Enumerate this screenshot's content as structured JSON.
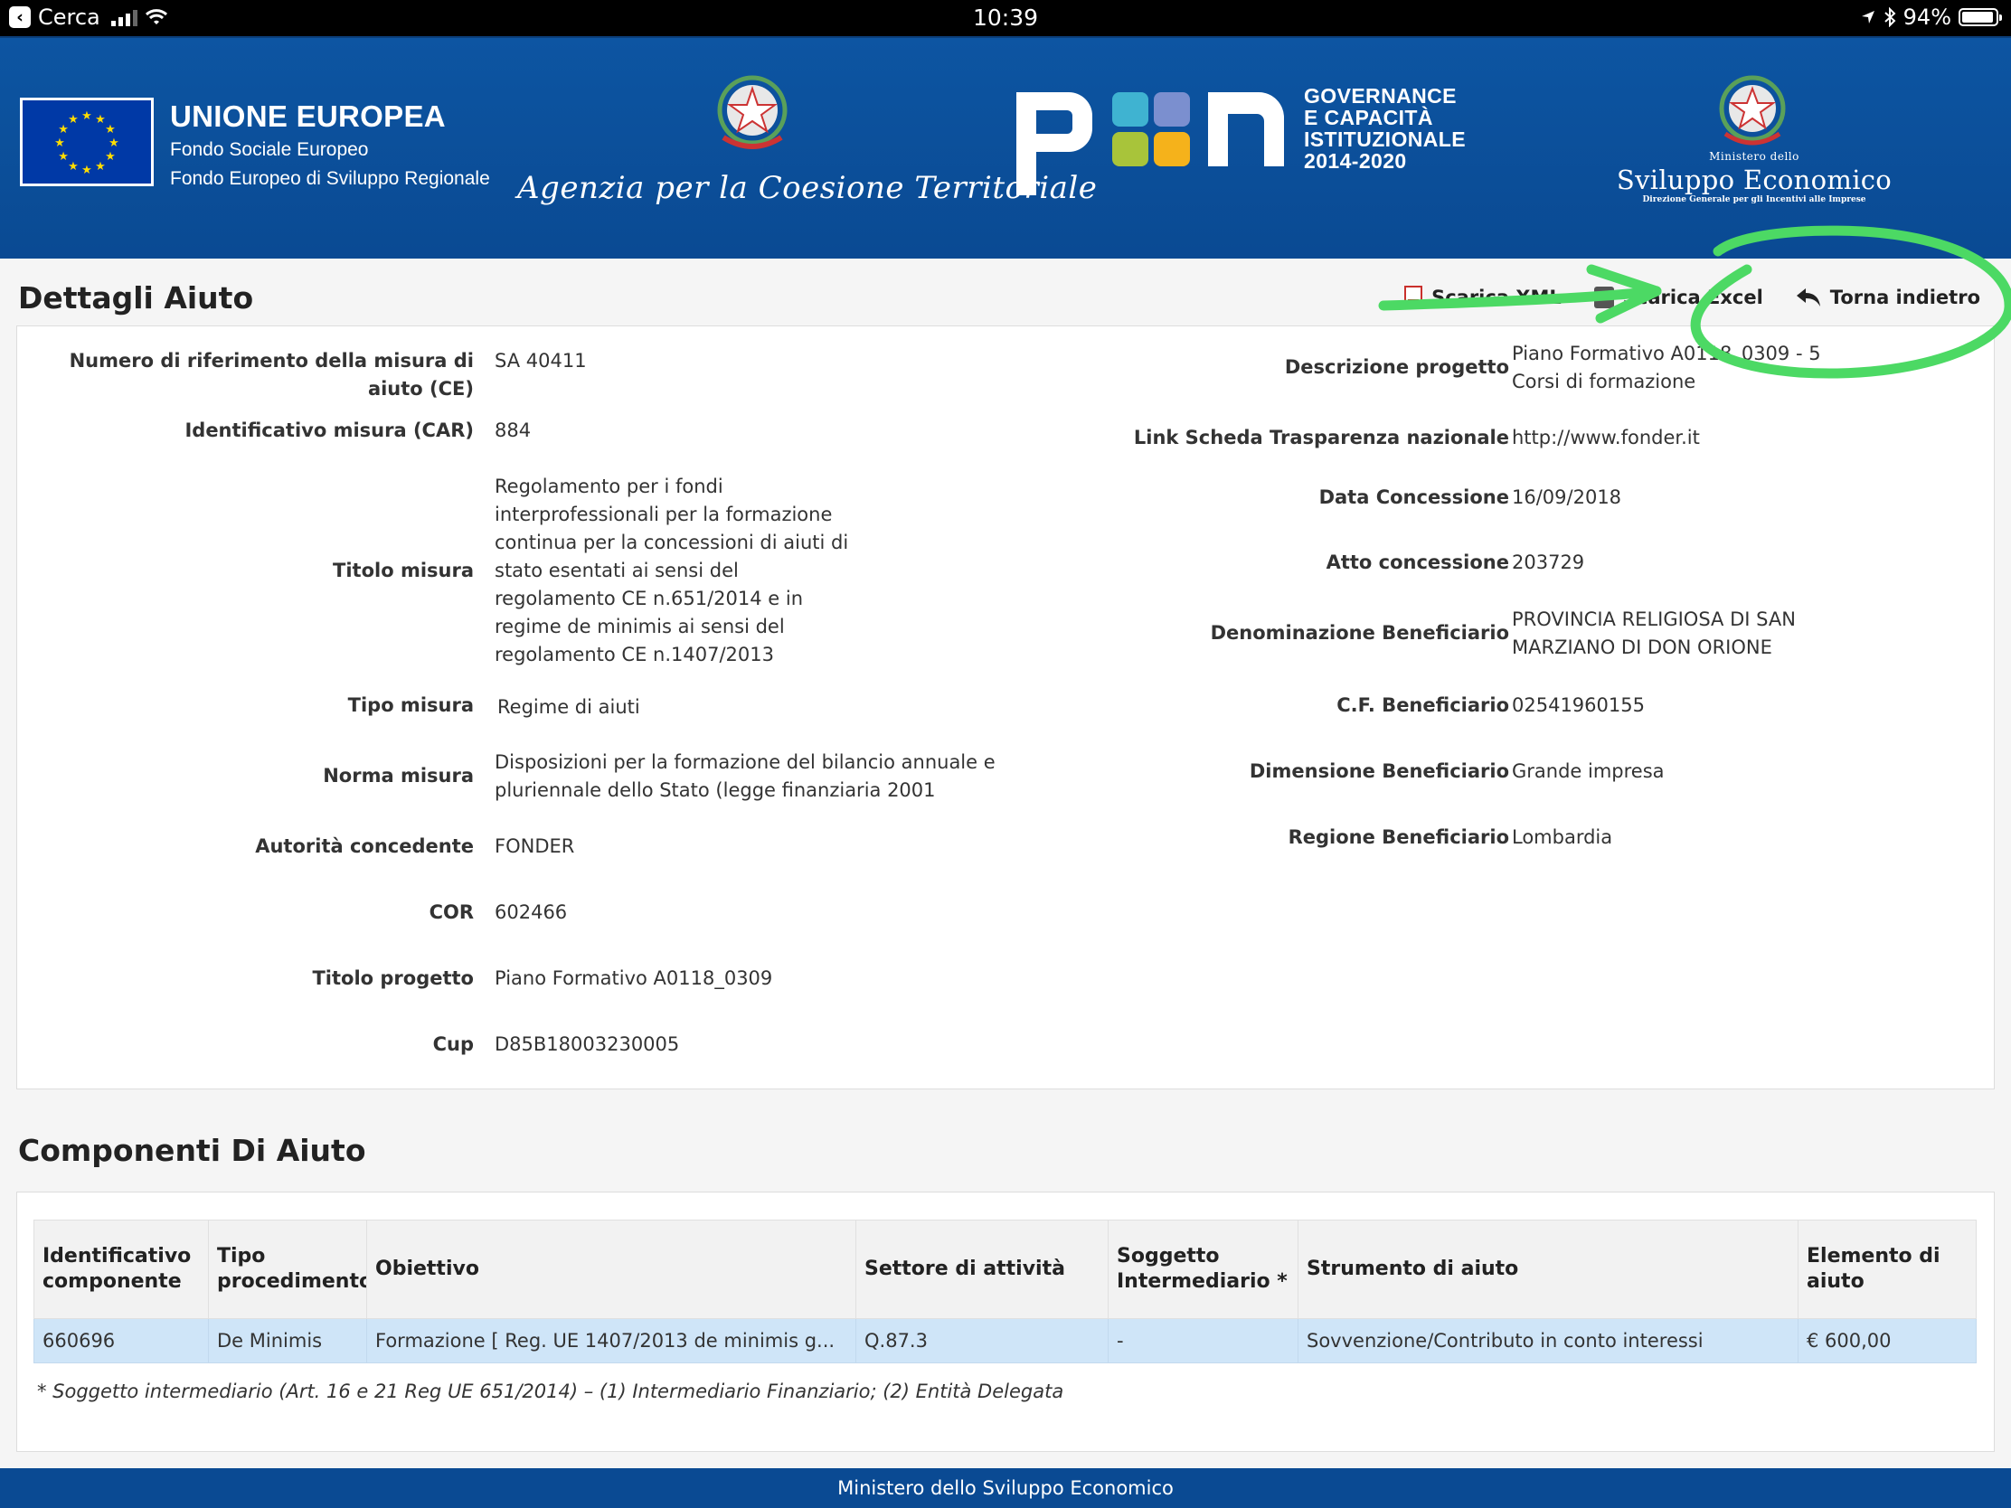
{
  "status_bar": {
    "back_app": "Cerca",
    "time": "10:39",
    "battery": "94%",
    "battery_level": 0.94
  },
  "banner": {
    "eu_title": "UNIONE EUROPEA",
    "eu_line1": "Fondo Sociale Europeo",
    "eu_line2": "Fondo Europeo di Sviluppo Regionale",
    "agency": "Agenzia per la Coesione Territoriale",
    "pon_line1": "GOVERNANCE",
    "pon_line2": "E CAPACITÀ",
    "pon_line3": "ISTITUZIONALE",
    "pon_line4": "2014-2020",
    "mise_small": "Ministero dello",
    "mise_big": "Sviluppo Economico",
    "mise_tiny": "Direzione Generale per gli Incentivi alle Imprese"
  },
  "page": {
    "title": "Dettagli Aiuto",
    "actions": {
      "pdf": "Scarica XML",
      "excel": "Scarica Excel",
      "back": "Torna indietro"
    }
  },
  "details_left": [
    {
      "label": "Numero di riferimento della misura di aiuto (CE)",
      "value": "SA 40411"
    },
    {
      "label": "Identificativo misura (CAR)",
      "value": "884"
    },
    {
      "label": "Titolo misura",
      "value": "Regolamento per i fondi interprofessionali per la formazione continua per la concessioni di aiuti di stato esentati ai sensi del regolamento CE n.651/2014 e in regime de minimis ai sensi del regolamento CE n.1407/2013"
    },
    {
      "label": "Tipo misura",
      "value": "Regime di aiuti"
    },
    {
      "label": "Norma misura",
      "value": "Disposizioni per la formazione del bilancio annuale e pluriennale dello Stato (legge finanziaria 2001"
    },
    {
      "label": "Autorità concedente",
      "value": "FONDER"
    },
    {
      "label": "COR",
      "value": "602466"
    },
    {
      "label": "Titolo progetto",
      "value": "Piano Formativo A0118_0309"
    },
    {
      "label": "Cup",
      "value": "D85B18003230005"
    }
  ],
  "details_right": [
    {
      "label": "Descrizione progetto",
      "value": "Piano Formativo A0118_0309 - 5 Corsi di formazione"
    },
    {
      "label": "Link Scheda Trasparenza nazionale",
      "value": "http://www.fonder.it"
    },
    {
      "label": "Data Concessione",
      "value": "16/09/2018"
    },
    {
      "label": "Atto concessione",
      "value": "203729"
    },
    {
      "label": "Denominazione Beneficiario",
      "value": "PROVINCIA RELIGIOSA DI SAN MARZIANO DI DON ORIONE"
    },
    {
      "label": "C.F. Beneficiario",
      "value": "02541960155"
    },
    {
      "label": "Dimensione Beneficiario",
      "value": "Grande impresa"
    },
    {
      "label": "Regione Beneficiario",
      "value": "Lombardia"
    }
  ],
  "components": {
    "title": "Componenti Di Aiuto",
    "headers": [
      "Identificativo componente",
      "Tipo procedimento",
      "Obiettivo",
      "Settore di attività",
      "Soggetto Intermediario *",
      "Strumento di aiuto",
      "Elemento di aiuto"
    ],
    "rows": [
      [
        "660696",
        "De Minimis",
        "Formazione [ Reg. UE 1407/2013 de minimis g...",
        "Q.87.3",
        "-",
        "Sovvenzione/Contributo in conto interessi",
        "€ 600,00"
      ]
    ],
    "footnote": "* Soggetto intermediario (Art. 16 e 21 Reg UE 651/2014) – (1) Intermediario Finanziario; (2) Entità Delegata"
  },
  "footer": "Ministero dello Sviluppo Economico",
  "colors": {
    "banner": "#0d55a2",
    "annotation": "#4cd964",
    "row_highlight": "#cfe5f8"
  }
}
